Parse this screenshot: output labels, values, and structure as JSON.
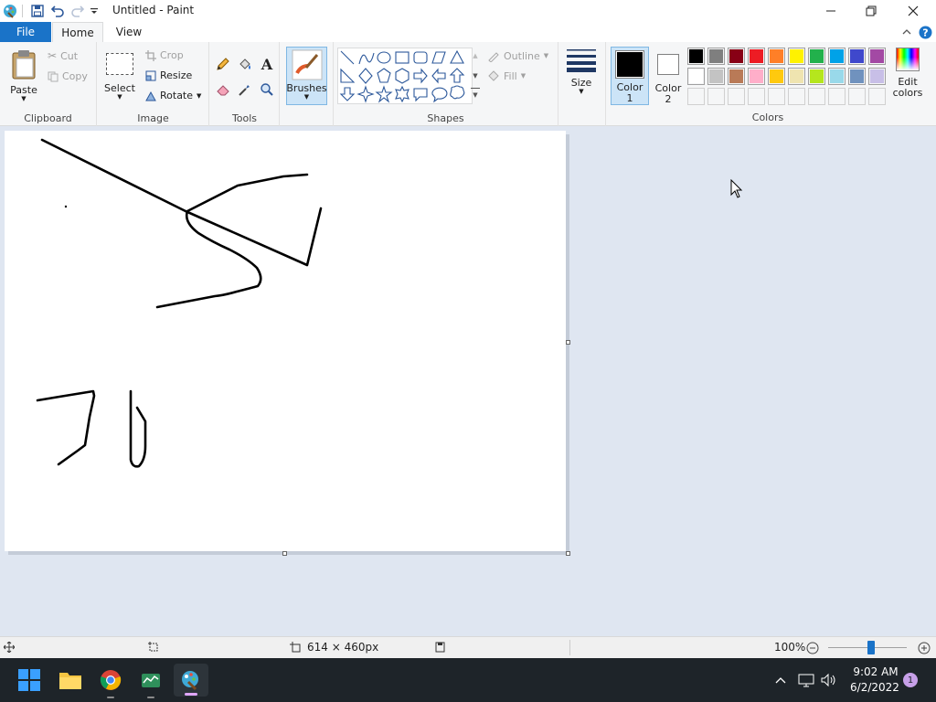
{
  "window": {
    "title": "Untitled - Paint"
  },
  "tabs": [
    {
      "label": "File"
    },
    {
      "label": "Home"
    },
    {
      "label": "View"
    }
  ],
  "ribbon": {
    "clipboard": {
      "label": "Clipboard",
      "paste": "Paste",
      "cut": "Cut",
      "copy": "Copy"
    },
    "image": {
      "label": "Image",
      "select": "Select",
      "crop": "Crop",
      "resize": "Resize",
      "rotate": "Rotate"
    },
    "tools": {
      "label": "Tools"
    },
    "brushes": {
      "label": "Brushes"
    },
    "shapes": {
      "label": "Shapes",
      "outline": "Outline",
      "fill": "Fill"
    },
    "size": {
      "label": "Size"
    },
    "color1": {
      "line1": "Color",
      "line2": "1",
      "value": "#000000"
    },
    "color2": {
      "line1": "Color",
      "line2": "2",
      "value": "#ffffff"
    },
    "colors": {
      "label": "Colors",
      "edit_line1": "Edit",
      "edit_line2": "colors"
    }
  },
  "palette": {
    "row1": [
      "#000000",
      "#7f7f7f",
      "#880015",
      "#ed1c24",
      "#ff7f27",
      "#fff200",
      "#22b14c",
      "#00a2e8",
      "#3f48cc",
      "#a349a4"
    ],
    "row2": [
      "#ffffff",
      "#c3c3c3",
      "#b97a57",
      "#ffaec9",
      "#ffc90e",
      "#efe4b0",
      "#b5e61d",
      "#99d9ea",
      "#7092be",
      "#c8bfe7"
    ],
    "row3_count": 10
  },
  "status": {
    "canvas_size": "614 × 460px",
    "zoom": "100%",
    "zoom_fraction": 0.55
  },
  "taskbar": {
    "time": "9:02 AM",
    "date": "6/2/2022",
    "notifications": "1"
  },
  "icons": {
    "start": "windows-start-icon",
    "explorer": "file-explorer-icon",
    "chrome": "chrome-icon",
    "app3": "task-manager-icon",
    "paint": "paint-icon"
  }
}
